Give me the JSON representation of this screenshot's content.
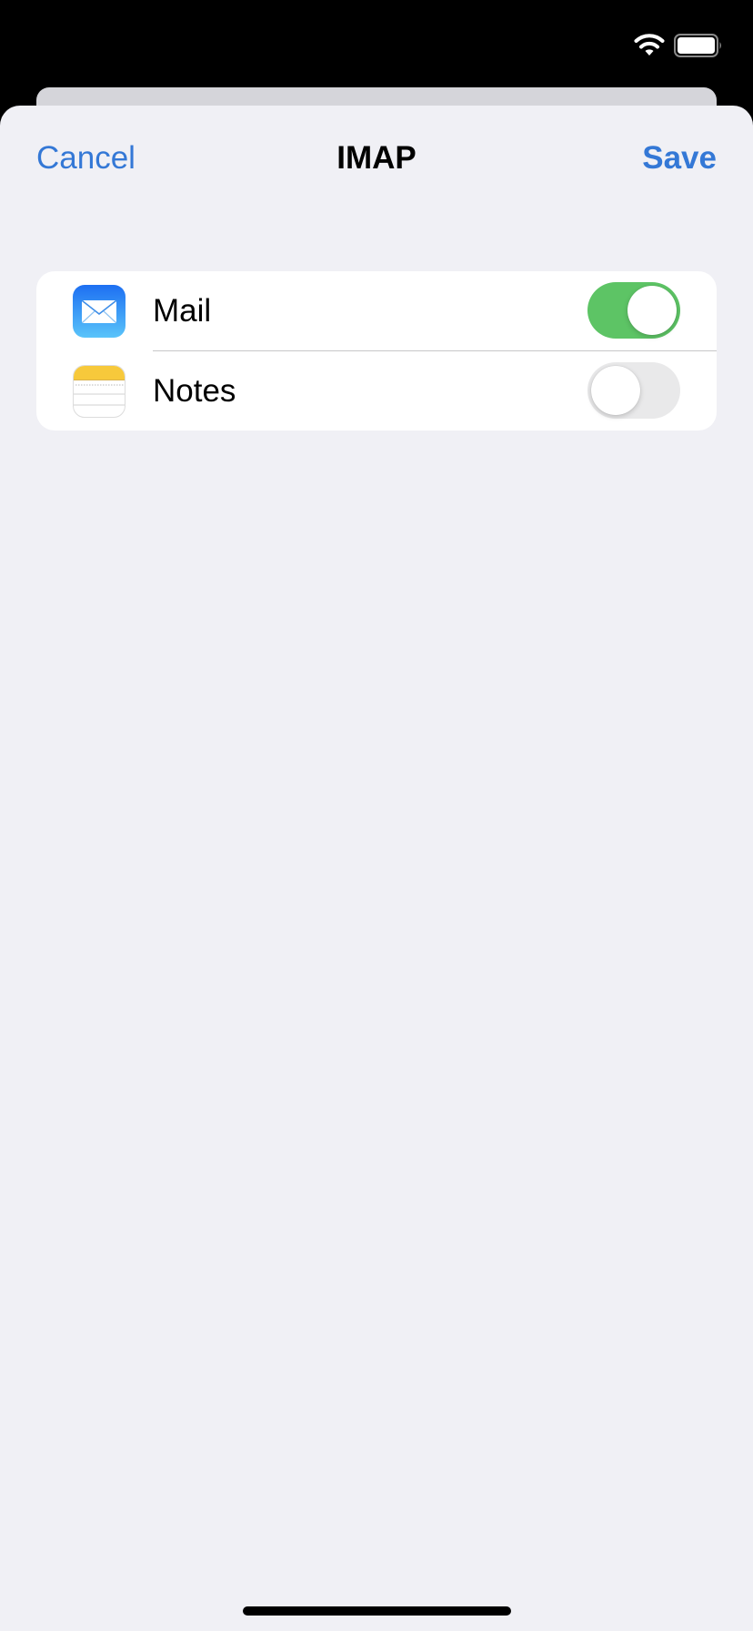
{
  "status_bar": {
    "wifi_icon": "wifi-icon",
    "battery_icon": "battery-icon"
  },
  "nav": {
    "cancel_label": "Cancel",
    "title": "IMAP",
    "save_label": "Save"
  },
  "services": [
    {
      "label": "Mail",
      "icon": "mail-app-icon",
      "enabled": true
    },
    {
      "label": "Notes",
      "icon": "notes-app-icon",
      "enabled": false
    }
  ],
  "colors": {
    "accent": "#3478d6",
    "toggle_on": "#5dc465",
    "toggle_off": "#e9e9ea",
    "sheet_background": "#f0f0f5"
  }
}
